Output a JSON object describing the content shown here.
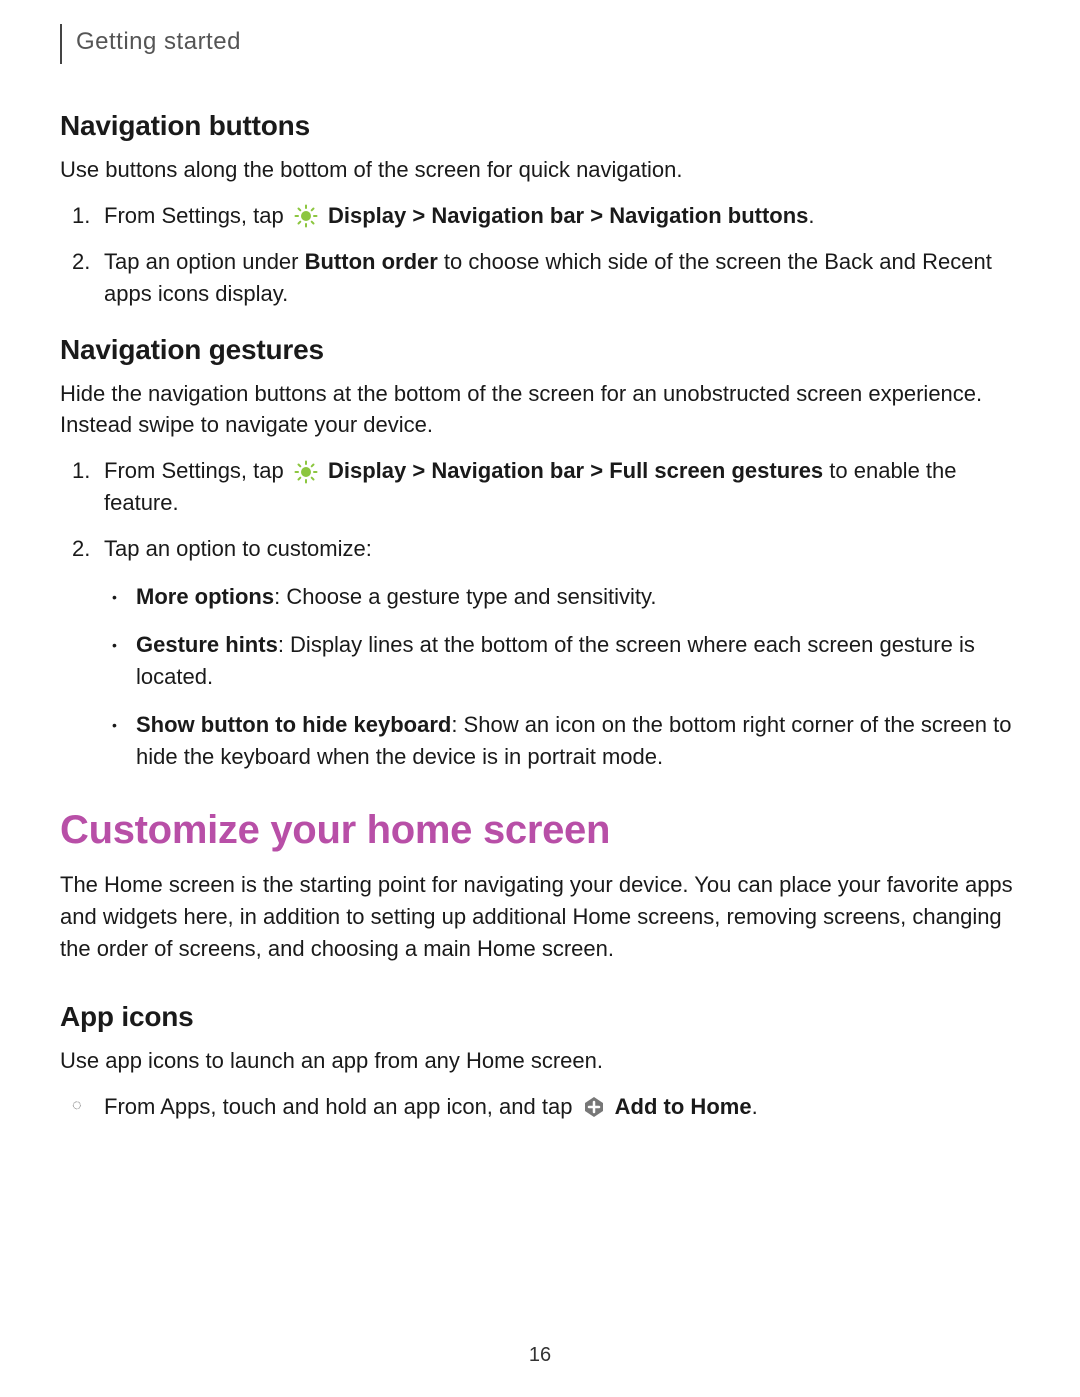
{
  "header": {
    "section": "Getting started"
  },
  "nav_buttons": {
    "heading": "Navigation buttons",
    "intro": "Use buttons along the bottom of the screen for quick navigation.",
    "step1_prefix": "From Settings, tap ",
    "step1_bold": "Display > Navigation bar > Navigation buttons",
    "step1_suffix": ".",
    "step2_prefix": "Tap an option under ",
    "step2_bold": "Button order",
    "step2_suffix": " to choose which side of the screen the Back and Recent apps icons display."
  },
  "nav_gestures": {
    "heading": "Navigation gestures",
    "intro": "Hide the navigation buttons at the bottom of the screen for an unobstructed screen experience. Instead swipe to navigate your device.",
    "step1_prefix": "From Settings, tap ",
    "step1_bold": "Display > Navigation bar > Full screen gestures",
    "step1_suffix": " to enable the feature.",
    "step2": "Tap an option to customize:",
    "bullet1_bold": "More options",
    "bullet1_text": ": Choose a gesture type and sensitivity.",
    "bullet2_bold": "Gesture hints",
    "bullet2_text": ": Display lines at the bottom of the screen where each screen gesture is located.",
    "bullet3_bold": "Show button to hide keyboard",
    "bullet3_text": ": Show an icon on the bottom right corner of the screen to hide the keyboard when the device is in portrait mode."
  },
  "home_screen": {
    "heading": "Customize your home screen",
    "intro": "The Home screen is the starting point for navigating your device. You can place your favorite apps and widgets here, in addition to setting up additional Home screens, removing screens, changing the order of screens, and choosing a main Home screen."
  },
  "app_icons": {
    "heading": "App icons",
    "intro": "Use app icons to launch an app from any Home screen.",
    "bullet_prefix": "From Apps, touch and hold an app icon, and tap ",
    "bullet_bold": "Add to Home",
    "bullet_suffix": "."
  },
  "page_number": "16"
}
